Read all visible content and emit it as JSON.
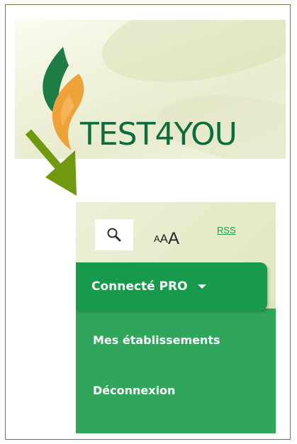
{
  "brand": {
    "name": "TEST4YOU",
    "colors": {
      "text_green": "#0d6b3c",
      "leaf_orange": "#f0a23a",
      "leaf_green": "#1e7c46"
    }
  },
  "toolbar": {
    "search_icon": "search-icon",
    "font_size_letters": [
      "A",
      "A",
      "A"
    ],
    "rss_label": "RSS"
  },
  "menu": {
    "toggle_label": "Connecté PRO",
    "caret_icon": "caret-down-icon",
    "items": [
      {
        "label": "Mes établissements"
      },
      {
        "label": "Déconnexion"
      }
    ],
    "colors": {
      "toggle_bg": "#179a4b",
      "dropdown_bg": "#2fa65b"
    }
  },
  "annotation": {
    "arrow_color": "#6f9a10"
  }
}
